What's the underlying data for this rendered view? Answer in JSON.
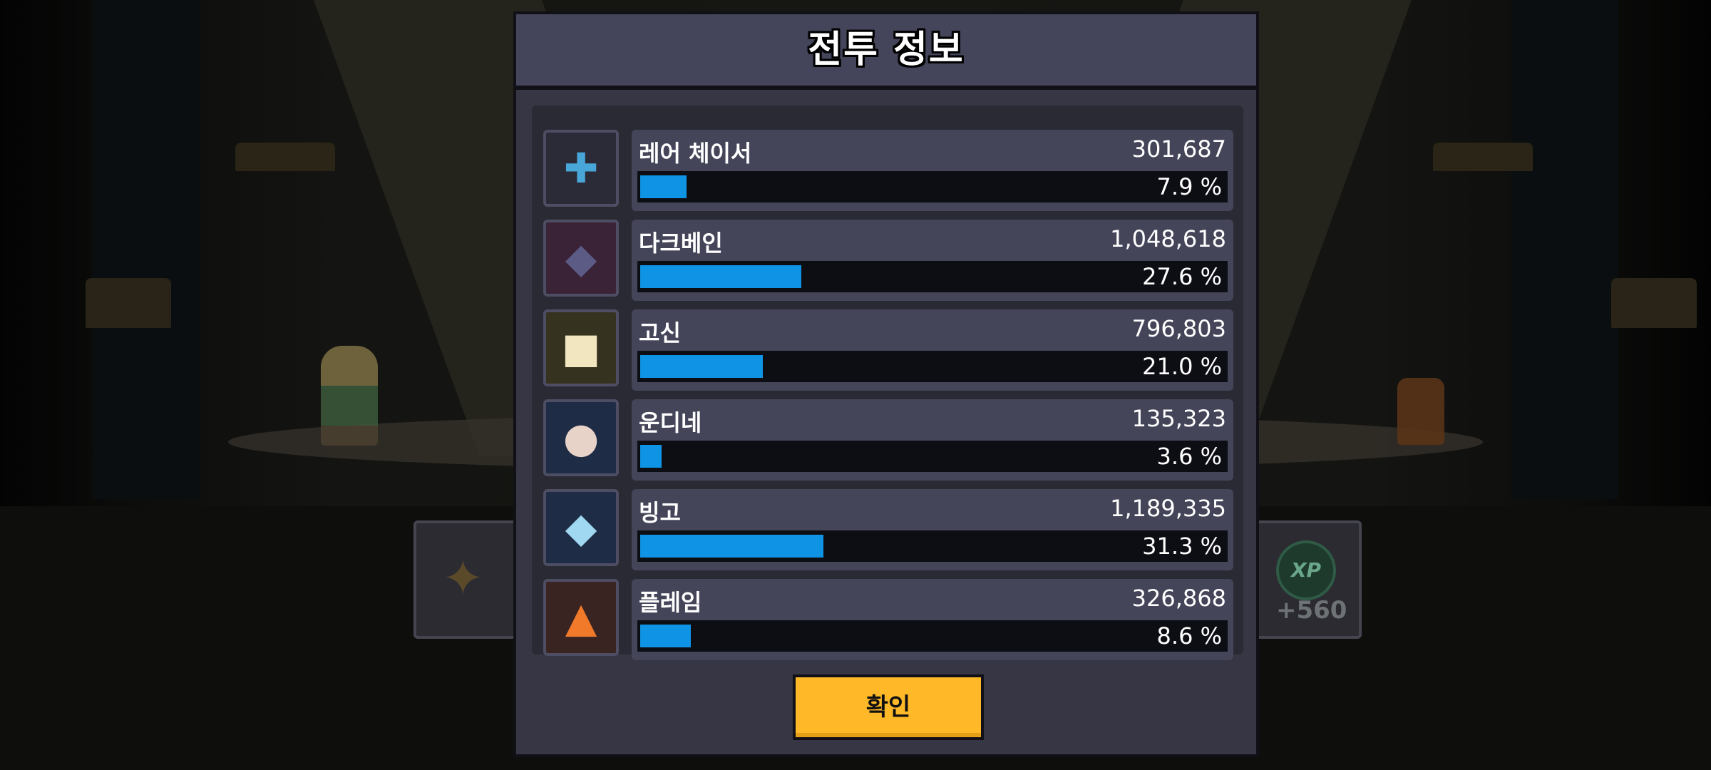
{
  "dialog": {
    "title": "전투 정보",
    "confirm_label": "확인"
  },
  "background": {
    "xp_icon_text": "XP",
    "xp_reward": "+560"
  },
  "rows": [
    {
      "name": "레어 체이서",
      "damage": "301,687",
      "percent": "7.9 %",
      "share": 7.9,
      "icon": "blaster-gun-icon",
      "frame": "#2b2b38"
    },
    {
      "name": "다크베인",
      "damage": "1,048,618",
      "percent": "27.6 %",
      "share": 27.6,
      "icon": "dark-wolf-pet-icon",
      "frame": "#3a2237"
    },
    {
      "name": "고신",
      "damage": "796,803",
      "percent": "21.0 %",
      "share": 21.0,
      "icon": "white-cat-pet-icon",
      "frame": "#35321f"
    },
    {
      "name": "운디네",
      "damage": "135,323",
      "percent": "3.6 %",
      "share": 3.6,
      "icon": "water-spirit-pet-icon",
      "frame": "#1f2c46"
    },
    {
      "name": "빙고",
      "damage": "1,189,335",
      "percent": "31.3 %",
      "share": 31.3,
      "icon": "ice-spirit-pet-icon",
      "frame": "#1f2c46"
    },
    {
      "name": "플레임",
      "damage": "326,868",
      "percent": "8.6 %",
      "share": 8.6,
      "icon": "fire-fox-pet-icon",
      "frame": "#3a2422"
    }
  ],
  "colors": {
    "bar": "#0f93e4",
    "button": "#ffb928"
  }
}
